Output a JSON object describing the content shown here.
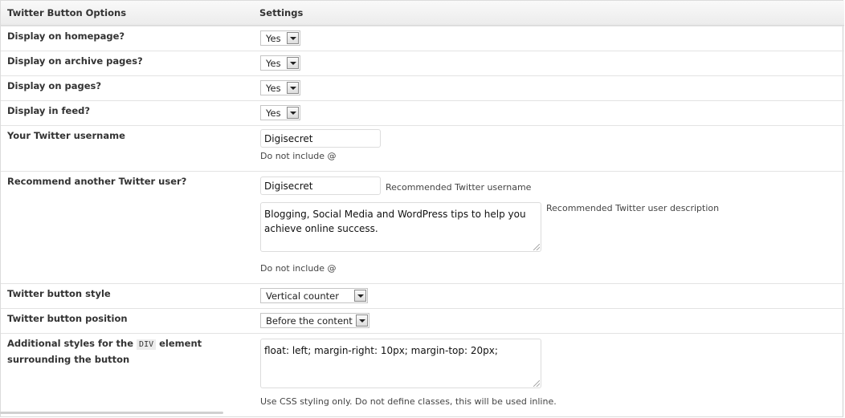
{
  "header": {
    "options": "Twitter Button Options",
    "settings": "Settings"
  },
  "rows": {
    "homepage": {
      "label": "Display on homepage?",
      "value": "Yes"
    },
    "archive": {
      "label": "Display on archive pages?",
      "value": "Yes"
    },
    "pages": {
      "label": "Display on pages?",
      "value": "Yes"
    },
    "feed": {
      "label": "Display in feed?",
      "value": "Yes"
    },
    "username": {
      "label": "Your Twitter username",
      "value": "Digisecret",
      "hint": "Do not include @"
    },
    "recommend": {
      "label": "Recommend another Twitter user?",
      "value": "Digisecret",
      "value_label": "Recommended Twitter username",
      "description": "Blogging, Social Media and WordPress tips to help you achieve online success.",
      "description_label": "Recommended Twitter user description",
      "hint": "Do not include @"
    },
    "style": {
      "label": "Twitter button style",
      "value": "Vertical counter"
    },
    "position": {
      "label": "Twitter button position",
      "value": "Before the content"
    },
    "styles": {
      "label_pre": "Additional styles for the",
      "label_code": "DIV",
      "label_post": "element",
      "label_line2": "surrounding the button",
      "value": "float: left; margin-right: 10px; margin-top: 20px;",
      "hint": "Use CSS styling only. Do not define classes, this will be used inline."
    }
  }
}
